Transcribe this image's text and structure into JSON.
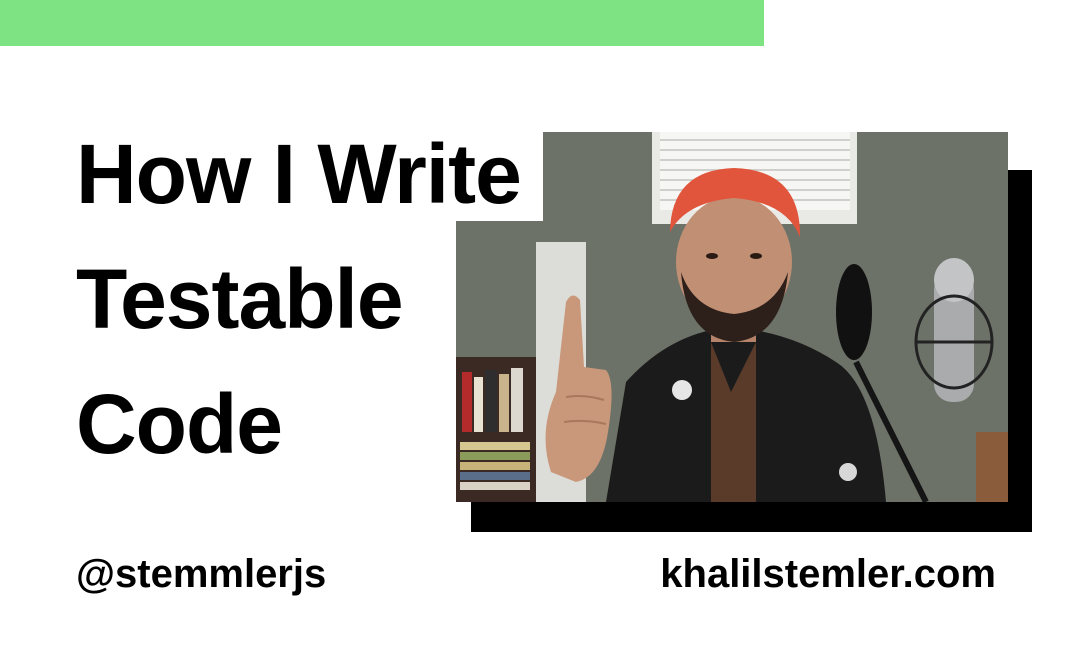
{
  "title_lines": [
    "How I Write",
    "Testable",
    "Code"
  ],
  "handle": "@stemmlerjs",
  "website": "khalilstemler.com",
  "colors": {
    "accent_bar": "#7ee382",
    "text": "#000000",
    "background": "#ffffff",
    "photo_shadow": "#000000"
  }
}
